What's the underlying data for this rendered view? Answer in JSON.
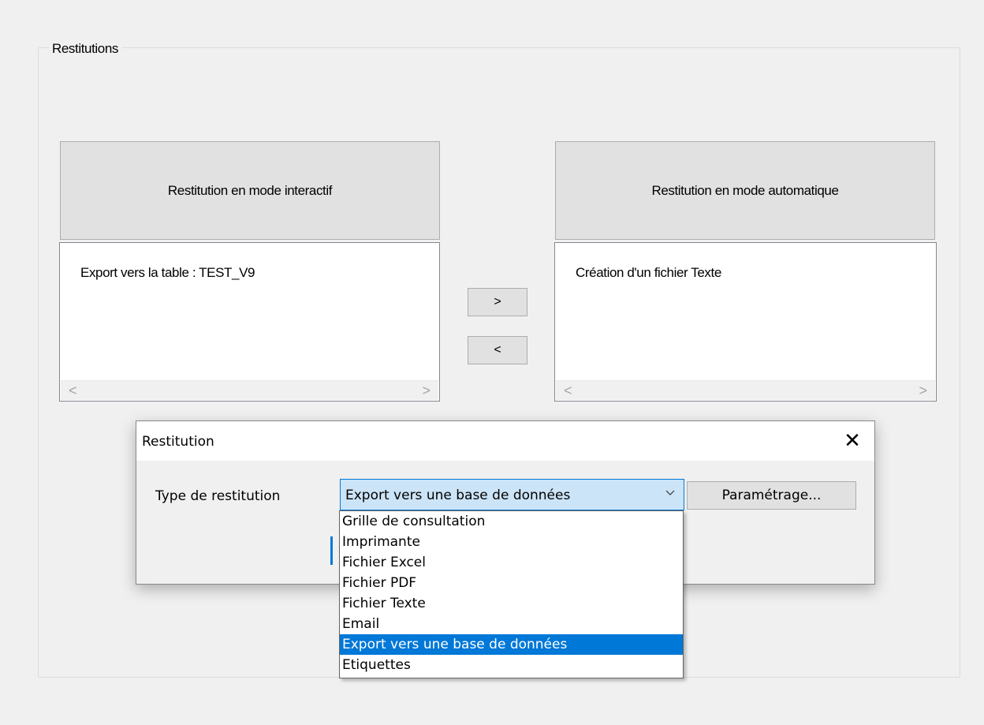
{
  "group": {
    "title": "Restitutions"
  },
  "interactive": {
    "header": "Restitution en mode interactif",
    "items": [
      "Export vers la table : TEST_V9"
    ]
  },
  "automatic": {
    "header": "Restitution en mode automatique",
    "items": [
      "Création d'un fichier Texte"
    ]
  },
  "move_buttons": {
    "right": ">",
    "left": "<"
  },
  "scroll_arrows": {
    "left": "<",
    "right": ">"
  },
  "dialog": {
    "title": "Restitution",
    "close": "✕",
    "type_label": "Type de restitution",
    "selected_type": "Export vers une base de données",
    "settings_button": "Paramétrage...",
    "options": [
      "Grille de consultation",
      "Imprimante",
      "Fichier Excel",
      "Fichier PDF",
      "Fichier Texte",
      "Email",
      "Export vers une base de données",
      "Etiquettes"
    ],
    "selected_index": 6
  },
  "colors": {
    "selection": "#0078d7",
    "combo_focus_bg": "#cce4f7",
    "button_bg": "#e1e1e1",
    "window_bg": "#f0f0f0"
  }
}
